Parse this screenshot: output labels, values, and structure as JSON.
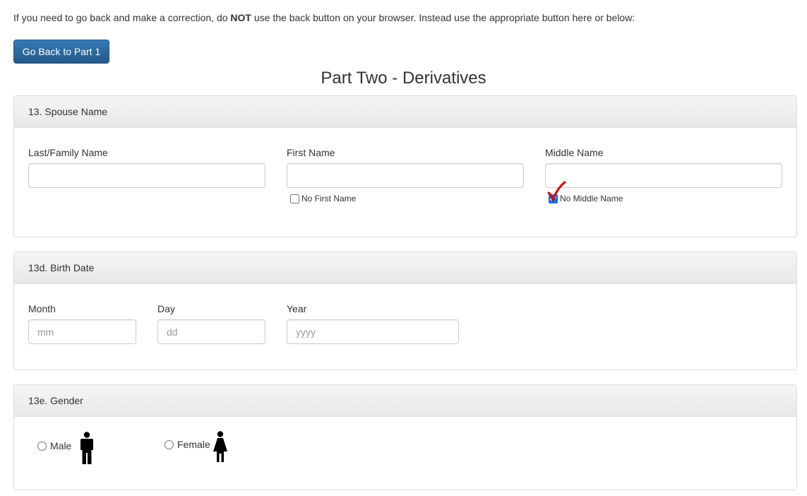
{
  "notice": {
    "prefix": "If you need to go back and make a correction, do ",
    "emphasis": "NOT",
    "suffix": " use the back button on your browser. Instead use the appropriate button here or below:"
  },
  "back_button": {
    "label": "Go Back to Part 1"
  },
  "page_title": "Part Two - Derivatives",
  "spouse_name": {
    "heading": "13. Spouse Name",
    "last_name": {
      "label": "Last/Family Name",
      "value": "",
      "placeholder": ""
    },
    "first_name": {
      "label": "First Name",
      "value": "",
      "placeholder": ""
    },
    "middle_name": {
      "label": "Middle Name",
      "value": "",
      "placeholder": ""
    },
    "no_first_name": {
      "label": "No First Name",
      "checked": false
    },
    "no_middle_name": {
      "label": "No Middle Name",
      "checked": true
    }
  },
  "birth_date": {
    "heading": "13d. Birth Date",
    "month": {
      "label": "Month",
      "placeholder": "mm"
    },
    "day": {
      "label": "Day",
      "placeholder": "dd"
    },
    "year": {
      "label": "Year",
      "placeholder": "yyyy"
    }
  },
  "gender": {
    "heading": "13e. Gender",
    "male": {
      "label": "Male",
      "icon": "male-person-icon"
    },
    "female": {
      "label": "Female",
      "icon": "female-person-icon"
    }
  },
  "colors": {
    "primary_button": "#337ab7",
    "check_mark": "#cc1111"
  }
}
